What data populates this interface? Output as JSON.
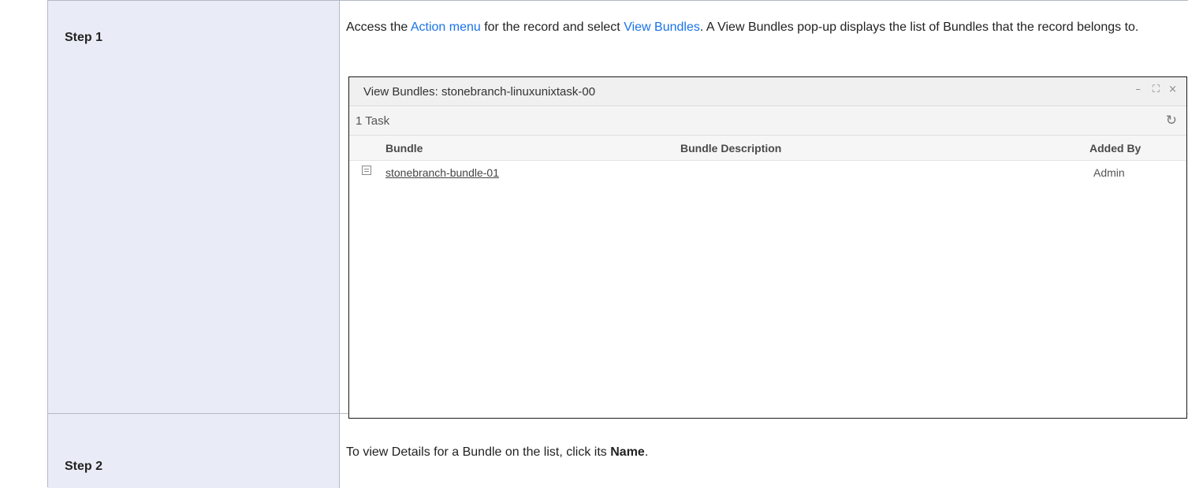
{
  "steps": [
    {
      "label": "Step 1",
      "text_before": "Access the ",
      "link1": "Action menu",
      "text_middle": " for the record and select ",
      "link2": "View Bundles",
      "text_after": ". A View Bundles pop-up displays the list of Bundles that the record belongs to."
    },
    {
      "label": "Step 2",
      "text_before": "To view Details for a Bundle on the list, click its ",
      "bold": "Name",
      "text_after": "."
    }
  ],
  "popup": {
    "title": "View Bundles: stonebranch-linuxunixtask-00",
    "controls": {
      "minimize": "–",
      "maximize": "⛶",
      "close": "×"
    },
    "count_label": "1 Task",
    "refresh_icon": "refresh-icon",
    "columns": [
      "Bundle",
      "Bundle Description",
      "Added By"
    ],
    "rows": [
      {
        "bundle": "stonebranch-bundle-01",
        "description": "",
        "added_by": "Admin"
      }
    ]
  },
  "colors": {
    "link": "#1a73e8",
    "label_bg": "#e9ecf6",
    "border": "#b3b8c4"
  }
}
